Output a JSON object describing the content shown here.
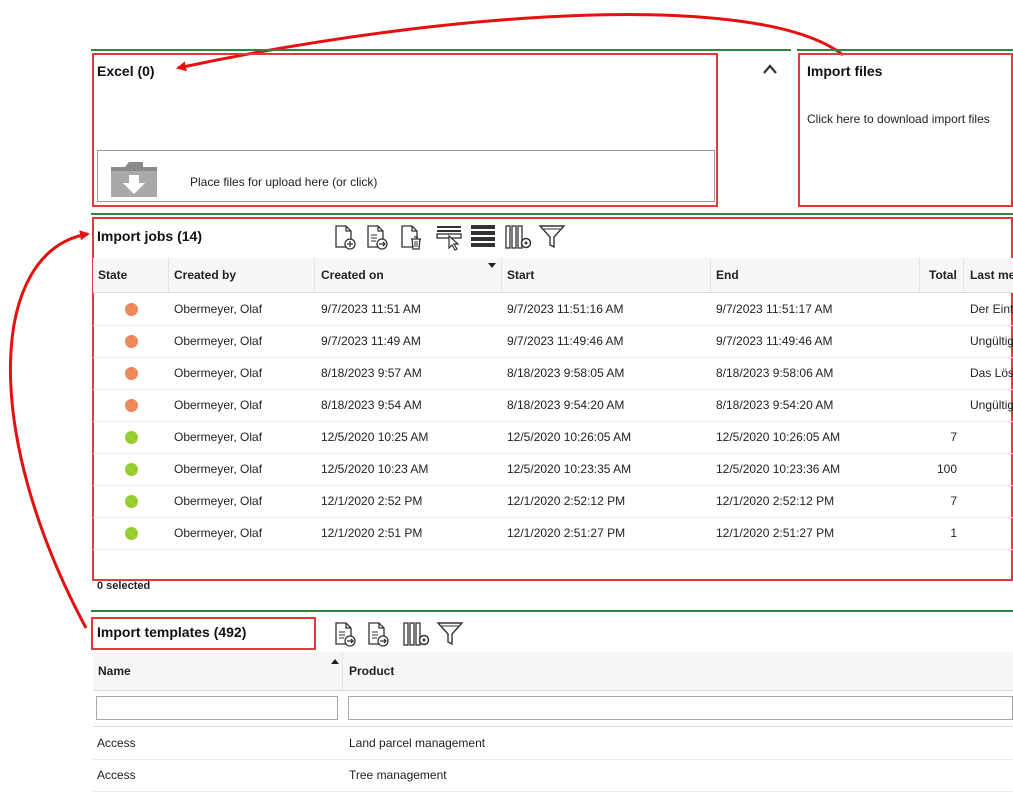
{
  "excel": {
    "title": "Excel (0)",
    "upload_text": "Place files for upload here (or click)"
  },
  "import_files": {
    "title": "Import files",
    "download_text": "Click here to download import files"
  },
  "import_jobs": {
    "title": "Import jobs (14)",
    "columns": [
      "State",
      "Created by",
      "Created on",
      "Start",
      "End",
      "Total",
      "Last me"
    ],
    "rows": [
      {
        "state": "warning",
        "created_by": "Obermeyer, Olaf",
        "created_on": "9/7/2023 11:51 AM",
        "start": "9/7/2023 11:51:16 AM",
        "end": "9/7/2023 11:51:17 AM",
        "total": "",
        "last_message": "Der Eint"
      },
      {
        "state": "warning",
        "created_by": "Obermeyer, Olaf",
        "created_on": "9/7/2023 11:49 AM",
        "start": "9/7/2023 11:49:46 AM",
        "end": "9/7/2023 11:49:46 AM",
        "total": "",
        "last_message": "Ungültig"
      },
      {
        "state": "warning",
        "created_by": "Obermeyer, Olaf",
        "created_on": "8/18/2023 9:57 AM",
        "start": "8/18/2023 9:58:05 AM",
        "end": "8/18/2023 9:58:06 AM",
        "total": "",
        "last_message": "Das Lös"
      },
      {
        "state": "warning",
        "created_by": "Obermeyer, Olaf",
        "created_on": "8/18/2023 9:54 AM",
        "start": "8/18/2023 9:54:20 AM",
        "end": "8/18/2023 9:54:20 AM",
        "total": "",
        "last_message": "Ungültig"
      },
      {
        "state": "success",
        "created_by": "Obermeyer, Olaf",
        "created_on": "12/5/2020 10:25 AM",
        "start": "12/5/2020 10:26:05 AM",
        "end": "12/5/2020 10:26:05 AM",
        "total": "7",
        "last_message": ""
      },
      {
        "state": "success",
        "created_by": "Obermeyer, Olaf",
        "created_on": "12/5/2020 10:23 AM",
        "start": "12/5/2020 10:23:35 AM",
        "end": "12/5/2020 10:23:36 AM",
        "total": "100",
        "last_message": ""
      },
      {
        "state": "success",
        "created_by": "Obermeyer, Olaf",
        "created_on": "12/1/2020 2:52 PM",
        "start": "12/1/2020 2:52:12 PM",
        "end": "12/1/2020 2:52:12 PM",
        "total": "7",
        "last_message": ""
      },
      {
        "state": "success",
        "created_by": "Obermeyer, Olaf",
        "created_on": "12/1/2020 2:51 PM",
        "start": "12/1/2020 2:51:27 PM",
        "end": "12/1/2020 2:51:27 PM",
        "total": "1",
        "last_message": ""
      }
    ],
    "selected_text": "0 selected"
  },
  "import_templates": {
    "title": "Import templates (492)",
    "columns": [
      "Name",
      "Product"
    ],
    "name_filter": "",
    "product_filter": "",
    "rows": [
      {
        "name": "Access",
        "product": "Land parcel management"
      },
      {
        "name": "Access",
        "product": "Tree management"
      }
    ]
  },
  "colors": {
    "accent_green": "#2e8540",
    "highlight_red": "#e03a3a",
    "state_warning": "#f0885a",
    "state_success": "#9acd32"
  },
  "icons": {
    "jobs_toolbar": [
      "new-job-icon",
      "run-job-icon",
      "delete-job-icon",
      "select-rows-icon",
      "list-view-icon",
      "column-settings-icon",
      "filter-icon"
    ],
    "templates_toolbar": [
      "run-template-icon",
      "export-template-icon",
      "column-settings-icon",
      "filter-icon"
    ]
  }
}
